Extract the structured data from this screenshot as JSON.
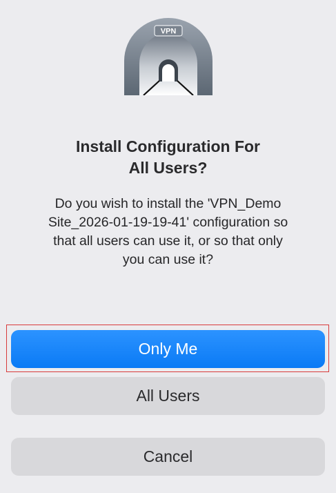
{
  "icon": {
    "name": "vpn-tunnel-icon",
    "label": "VPN"
  },
  "dialog": {
    "title_line1": "Install Configuration For",
    "title_line2": "All Users?",
    "message_line1": "Do you wish to install the 'VPN_Demo",
    "message_line2": "Site_2026-01-19-19-41' configuration so",
    "message_line3": "that all users can use it, or so that only",
    "message_line4": "you can use it?"
  },
  "buttons": {
    "only_me": "Only Me",
    "all_users": "All Users",
    "cancel": "Cancel"
  },
  "colors": {
    "primary": "#0a7af5",
    "secondary": "#d8d8db",
    "focus_ring": "#d83a3a"
  }
}
